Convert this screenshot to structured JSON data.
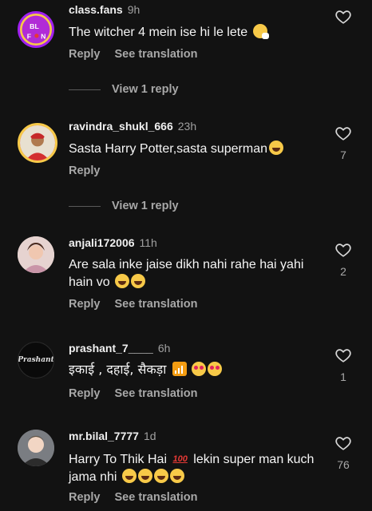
{
  "comments": [
    {
      "username": "class.fans",
      "time": "9h",
      "text": "The witcher 4 mein ise hi le lete",
      "emojis": [
        "sneeze"
      ],
      "actions": [
        "Reply",
        "See translation"
      ],
      "likes": "",
      "avatar": {
        "label": "BL F N",
        "colors": [
          "#a020f0",
          "#f7c948"
        ]
      },
      "view_replies": "View 1 reply"
    },
    {
      "username": "ravindra_shukl_666",
      "time": "23h",
      "text": "Sasta Harry Potter,sasta superman",
      "emojis": [
        "laugh"
      ],
      "actions": [
        "Reply"
      ],
      "likes": "7",
      "view_replies": "View 1 reply"
    },
    {
      "username": "anjali172006",
      "time": "11h",
      "text": "Are sala inke jaise dikh nahi rahe hai yahi hain vo",
      "emojis": [
        "laugh",
        "laugh"
      ],
      "actions": [
        "Reply",
        "See translation"
      ],
      "likes": "2"
    },
    {
      "username": "prashant_7____",
      "time": "6h",
      "text": "इकाई , दहाई, सैकड़ा",
      "emojis": [
        "signal",
        "love",
        "love"
      ],
      "actions": [
        "Reply",
        "See translation"
      ],
      "likes": "1",
      "avatar": {
        "label": "Prashant"
      }
    },
    {
      "username": "mr.bilal_7777",
      "time": "1d",
      "text_part1": "Harry To Thik Hai",
      "hundred": "100",
      "text_part2": "lekin super man kuch jama nhi",
      "emojis": [
        "laugh",
        "laugh",
        "laugh",
        "laugh"
      ],
      "actions": [
        "Reply",
        "See translation"
      ],
      "likes": "76"
    }
  ]
}
